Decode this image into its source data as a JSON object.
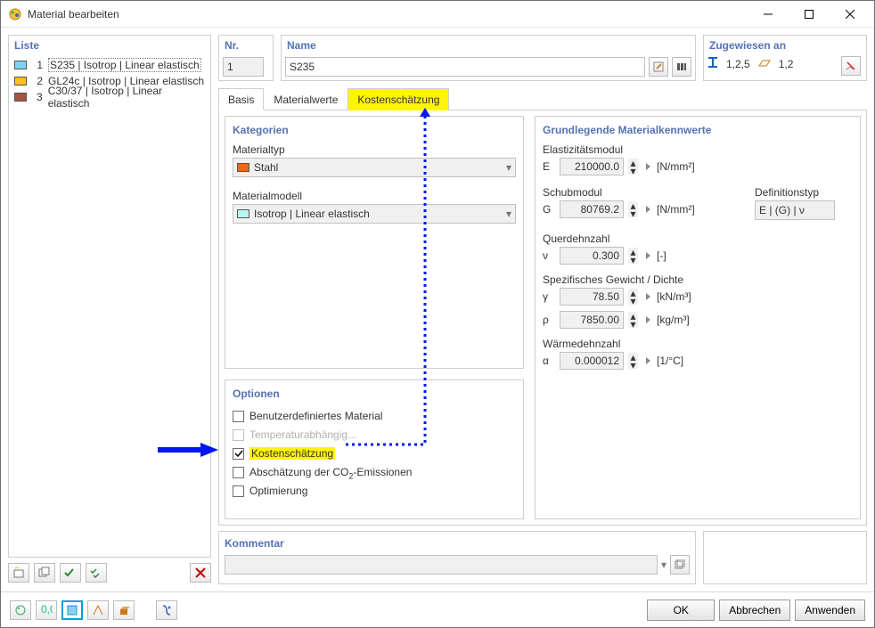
{
  "window": {
    "title": "Material bearbeiten"
  },
  "list": {
    "title": "Liste",
    "items": [
      {
        "num": "1",
        "label": "S235 | Isotrop | Linear elastisch",
        "color": "#7ed3f6"
      },
      {
        "num": "2",
        "label": "GL24c | Isotrop | Linear elastisch",
        "color": "#ffc017"
      },
      {
        "num": "3",
        "label": "C30/37 | Isotrop | Linear elastisch",
        "color": "#a65340"
      }
    ]
  },
  "header": {
    "nr_label": "Nr.",
    "nr_value": "1",
    "name_label": "Name",
    "name_value": "S235",
    "assigned_label": "Zugewiesen an",
    "assigned_items": [
      {
        "icon": "i-beam",
        "val": "1,2,5"
      },
      {
        "icon": "plate",
        "val": "1,2"
      }
    ]
  },
  "tabs": {
    "basis": "Basis",
    "werte": "Materialwerte",
    "kosten": "Kostenschätzung"
  },
  "categories": {
    "title": "Kategorien",
    "materialtyp_label": "Materialtyp",
    "materialtyp_value": "Stahl",
    "materialtyp_color": "#e8691b",
    "materialmodell_label": "Materialmodell",
    "materialmodell_value": "Isotrop | Linear elastisch",
    "materialmodell_color": "#b8f5f0"
  },
  "options": {
    "title": "Optionen",
    "benutzer": "Benutzerdefiniertes Material",
    "temp": "Temperaturabhängig...",
    "kosten": "Kostenschätzung",
    "co2_pre": "Abschätzung der CO",
    "co2_post": "-Emissionen",
    "opt": "Optimierung"
  },
  "props": {
    "title": "Grundlegende Materialkennwerte",
    "emod_label": "Elastizitätsmodul",
    "emod_sym": "E",
    "emod_val": "210000.0",
    "emod_unit": "[N/mm²]",
    "gmod_label": "Schubmodul",
    "gmod_sym": "G",
    "gmod_val": "80769.2",
    "gmod_unit": "[N/mm²]",
    "deftype_label": "Definitionstyp",
    "deftype_val": "E | (G) | ν",
    "poisson_label": "Querdehnzahl",
    "poisson_sym": "ν",
    "poisson_val": "0.300",
    "poisson_unit": "[-]",
    "weight_label": "Spezifisches Gewicht / Dichte",
    "gamma_sym": "γ",
    "gamma_val": "78.50",
    "gamma_unit": "[kN/m³]",
    "rho_sym": "ρ",
    "rho_val": "7850.00",
    "rho_unit": "[kg/m³]",
    "alpha_label": "Wärmedehnzahl",
    "alpha_sym": "α",
    "alpha_val": "0.000012",
    "alpha_unit": "[1/°C]"
  },
  "comment": {
    "title": "Kommentar"
  },
  "footer": {
    "ok": "OK",
    "cancel": "Abbrechen",
    "apply": "Anwenden"
  }
}
